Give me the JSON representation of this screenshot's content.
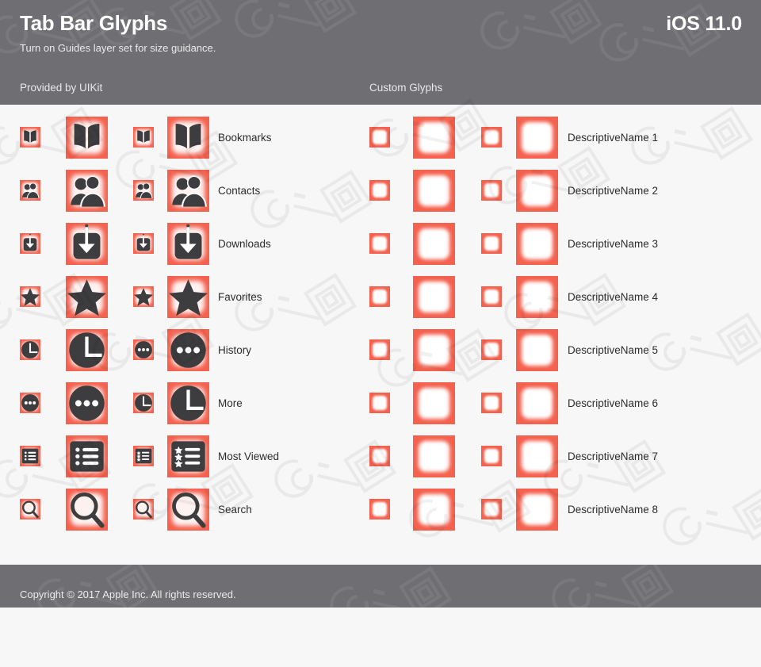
{
  "header": {
    "title": "Tab Bar Glyphs",
    "subtitle": "Turn on Guides layer set for size guidance.",
    "version": "iOS 11.0",
    "column_left": "Provided by UIKit",
    "column_right": "Custom Glyphs"
  },
  "footer": {
    "copyright": "Copyright © 2017 Apple Inc. All rights reserved."
  },
  "colors": {
    "header_bg": "#6e6e73",
    "body_bg": "#f7f7f7",
    "glyph_red": "#f4614e",
    "glyph_fill": "#3d3d3f",
    "label_text": "#2d2d2f",
    "header_text": "#ffffff"
  },
  "uikit_glyphs": [
    {
      "label": "Bookmarks",
      "left_icon": "book-icon",
      "right_icon": "book-icon"
    },
    {
      "label": "Contacts",
      "left_icon": "contacts-icon",
      "right_icon": "contacts-icon"
    },
    {
      "label": "Downloads",
      "left_icon": "download-icon",
      "right_icon": "download-icon"
    },
    {
      "label": "Favorites",
      "left_icon": "star-icon",
      "right_icon": "star-icon"
    },
    {
      "label": "History",
      "left_icon": "clock-icon",
      "right_icon": "ellipsis-icon"
    },
    {
      "label": "More",
      "left_icon": "ellipsis-icon",
      "right_icon": "clock-icon"
    },
    {
      "label": "Most Viewed",
      "left_icon": "list-icon",
      "right_icon": "star-list-icon"
    },
    {
      "label": "Search",
      "left_icon": "search-icon",
      "right_icon": "search-icon"
    }
  ],
  "custom_glyphs": [
    {
      "label": "DescriptiveName 1",
      "left_icon": "empty-placeholder-icon",
      "right_icon": "empty-placeholder-icon"
    },
    {
      "label": "DescriptiveName 2",
      "left_icon": "empty-placeholder-icon",
      "right_icon": "empty-placeholder-icon"
    },
    {
      "label": "DescriptiveName 3",
      "left_icon": "empty-placeholder-icon",
      "right_icon": "empty-placeholder-icon"
    },
    {
      "label": "DescriptiveName 4",
      "left_icon": "empty-placeholder-icon",
      "right_icon": "empty-placeholder-icon"
    },
    {
      "label": "DescriptiveName 5",
      "left_icon": "empty-placeholder-icon",
      "right_icon": "empty-placeholder-icon"
    },
    {
      "label": "DescriptiveName 6",
      "left_icon": "empty-placeholder-icon",
      "right_icon": "empty-placeholder-icon"
    },
    {
      "label": "DescriptiveName 7",
      "left_icon": "empty-placeholder-icon",
      "right_icon": "empty-placeholder-icon"
    },
    {
      "label": "DescriptiveName 8",
      "left_icon": "empty-placeholder-icon",
      "right_icon": "empty-placeholder-icon"
    }
  ]
}
